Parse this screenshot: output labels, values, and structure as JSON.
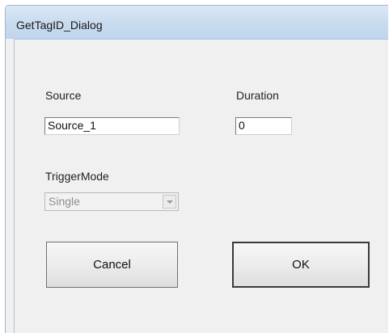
{
  "window": {
    "title": "GetTagID_Dialog"
  },
  "form": {
    "source": {
      "label": "Source",
      "value": "Source_1"
    },
    "duration": {
      "label": "Duration",
      "value": "0"
    },
    "trigger_mode": {
      "label": "TriggerMode",
      "selected": "Single",
      "enabled": false
    }
  },
  "buttons": {
    "cancel_label": "Cancel",
    "ok_label": "OK"
  },
  "icons": {
    "dropdown": "chevron-down-icon"
  },
  "colors": {
    "titlebar": "#c9dcef",
    "client_background": "#f0f0f0",
    "disabled_text": "#8e8e8e"
  }
}
